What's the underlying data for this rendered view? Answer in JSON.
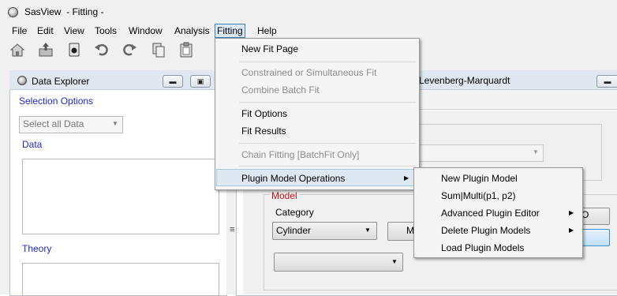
{
  "window": {
    "title": "SasView  - Fitting -"
  },
  "menubar": [
    "File",
    "Edit",
    "View",
    "Tools",
    "Window",
    "Analysis",
    "Fitting",
    "Help"
  ],
  "toolbar": {
    "icons": [
      "home-icon",
      "open-data-icon",
      "report-icon",
      "undo-icon",
      "redo-icon",
      "copy-icon",
      "paste-icon"
    ]
  },
  "data_explorer": {
    "title": "Data Explorer",
    "selection_options_label": "Selection Options",
    "select_value": "Select all Data",
    "data_label": "Data",
    "theory_label": "Theory"
  },
  "fit_window": {
    "title_partial": "Levenberg-Marquardt",
    "model_label": "Model",
    "category_label": "Category",
    "category_value": "Cylinder",
    "partial_button_text": "M",
    "right_button_partial": "O"
  },
  "fitting_menu": {
    "items": [
      {
        "label": "New Fit Page",
        "enabled": true
      },
      {
        "label": "Constrained or Simultaneous Fit",
        "enabled": false
      },
      {
        "label": "Combine Batch Fit",
        "enabled": false
      },
      {
        "label": "Fit Options",
        "enabled": true
      },
      {
        "label": "Fit Results",
        "enabled": true
      },
      {
        "label": "Chain Fitting [BatchFit Only]",
        "enabled": false
      },
      {
        "label": "Plugin Model Operations",
        "enabled": true
      }
    ]
  },
  "plugin_submenu": {
    "items": [
      {
        "label": "New Plugin Model",
        "has_submenu": false
      },
      {
        "label": "Sum|Multi(p1, p2)",
        "has_submenu": false
      },
      {
        "label": "Advanced Plugin Editor",
        "has_submenu": true
      },
      {
        "label": "Delete Plugin Models",
        "has_submenu": true
      },
      {
        "label": "Load Plugin Models",
        "has_submenu": false
      }
    ]
  },
  "colors": {
    "link_blue": "#1f2ac8",
    "model_red": "#cc1010",
    "highlight": "#dde8f3"
  }
}
